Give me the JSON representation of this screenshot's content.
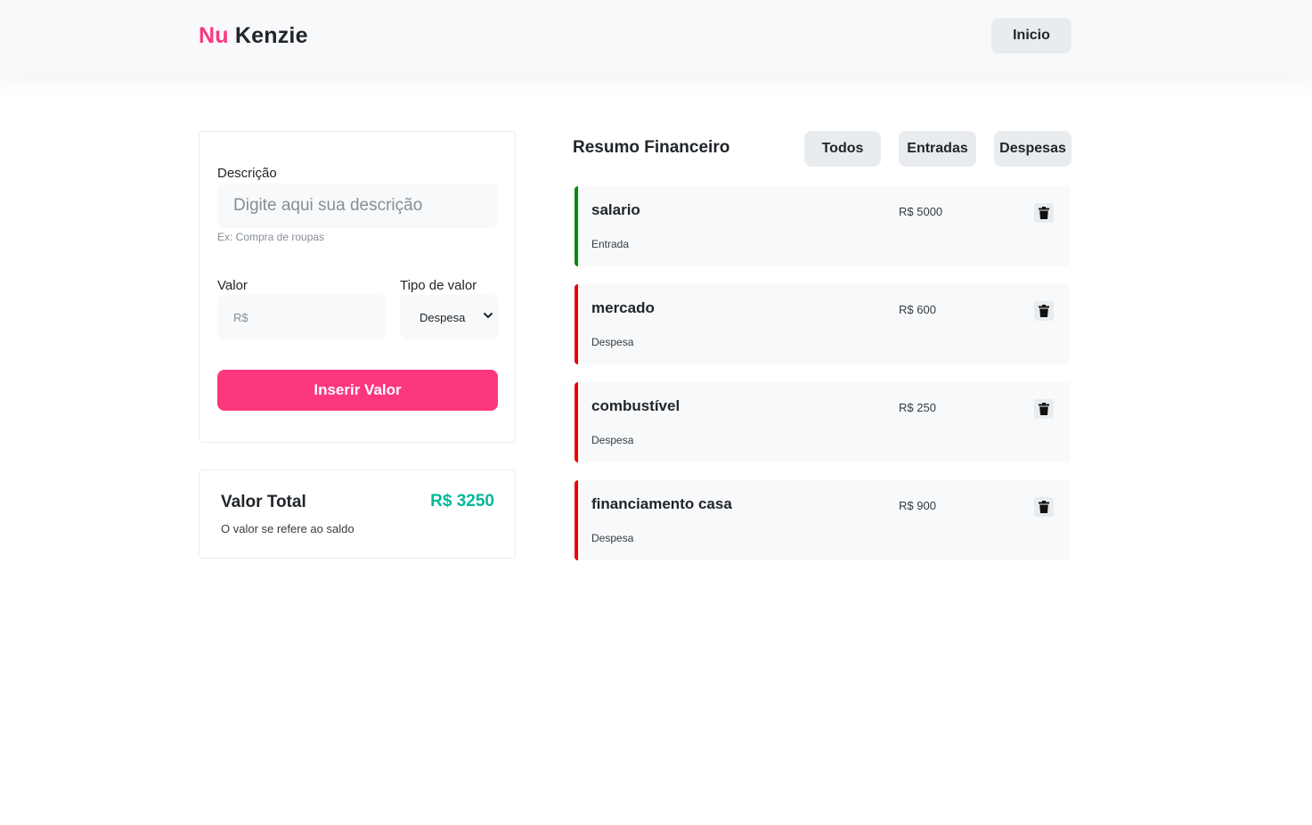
{
  "header": {
    "logo_part1": "Nu",
    "logo_part2": "Kenzie",
    "inicio_label": "Inicio"
  },
  "form": {
    "descricao_label": "Descrição",
    "descricao_placeholder": "Digite aqui sua descrição",
    "descricao_hint": "Ex: Compra de roupas",
    "valor_label": "Valor",
    "valor_placeholder": "R$",
    "tipo_label": "Tipo de valor",
    "tipo_selected": "Despesa",
    "submit_label": "Inserir Valor"
  },
  "total": {
    "title": "Valor Total",
    "value": "R$ 3250",
    "subtitle": "O valor se refere ao saldo"
  },
  "summary": {
    "title": "Resumo Financeiro",
    "filters": [
      "Todos",
      "Entradas",
      "Despesas"
    ]
  },
  "entries": [
    {
      "name": "salario",
      "value": "R$ 5000",
      "type": "Entrada"
    },
    {
      "name": "mercado",
      "value": "R$ 600",
      "type": "Despesa"
    },
    {
      "name": "combustível",
      "value": "R$ 250",
      "type": "Despesa"
    },
    {
      "name": "financiamento casa",
      "value": "R$ 900",
      "type": "Despesa"
    }
  ],
  "colors": {
    "brand_pink": "#fd377e",
    "total_green": "#03b898",
    "entrada_border": "#0a8a0a",
    "despesa_border": "#e00000"
  },
  "icons": {
    "trash": "trash-icon",
    "select_chevron": "chevron-down-icon"
  }
}
